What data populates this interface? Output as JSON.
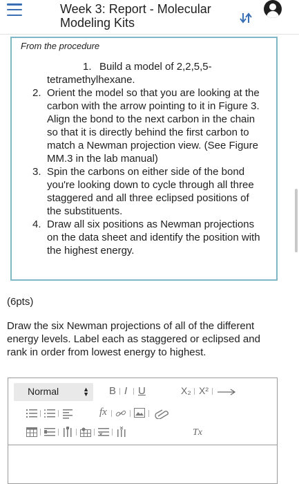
{
  "header": {
    "title": "Week 3: Report - Molecular Modeling Kits"
  },
  "procedure": {
    "heading": "From the procedure",
    "steps": [
      {
        "num": "1.",
        "text": "Build a model of 2,2,5,5-tetramethylhexane."
      },
      {
        "num": "2.",
        "text": "Orient the model so that you are looking at the carbon with the arrow pointing to it in Figure 3. Align the bond to the next carbon in the chain so that it is directly behind the first carbon to match a Newman projection view. (See Figure MM.3 in the lab manual)"
      },
      {
        "num": "3.",
        "text": "Spin the carbons on either side of the bond you're looking down to cycle through all three staggered and all three eclipsed positions of the substituents."
      },
      {
        "num": "4.",
        "text": "Draw all six positions as Newman projections on the data sheet and identify the position with the highest energy."
      }
    ]
  },
  "question": {
    "points": "(6pts)",
    "instructions": "Draw the six Newman projections of all of the different energy levels. Label each as staggered or eclipsed and rank in order from lowest energy to highest."
  },
  "editor": {
    "style_value": "Normal",
    "bold": "B",
    "italic": "I",
    "underline": "U",
    "subscript": "X₂",
    "superscript": "X²",
    "formula": "fx",
    "clear_format": "Tx"
  },
  "colors": {
    "accent": "#3a6fb5",
    "box_border": "#7fb7c7"
  }
}
